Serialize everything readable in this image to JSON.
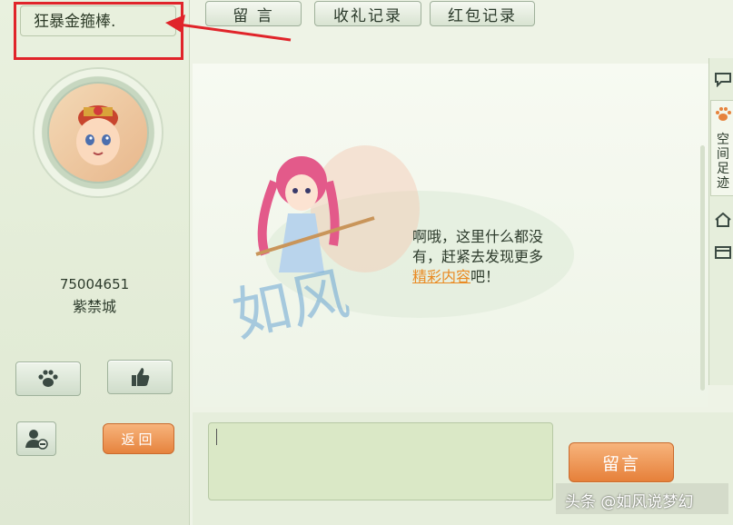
{
  "profile": {
    "name": "狂暴金箍棒.",
    "uid": "75004651",
    "location": "紫禁城",
    "back_label": "返回"
  },
  "tabs": [
    {
      "label": "留 言"
    },
    {
      "label": "收礼记录"
    },
    {
      "label": "红包记录"
    }
  ],
  "empty_state": {
    "text": "啊哦，这里什么都没有，赶紧去发现更多",
    "link": "精彩内容",
    "suffix": "吧！"
  },
  "side_tabs": {
    "active_label": "空间足迹"
  },
  "compose": {
    "input_value": "",
    "submit_label": "留言"
  },
  "watermark": "头条 @如风说梦幻",
  "colors": {
    "accent_orange": "#e6833d",
    "highlight_red": "#e0242a",
    "link_orange": "#e98a23"
  }
}
